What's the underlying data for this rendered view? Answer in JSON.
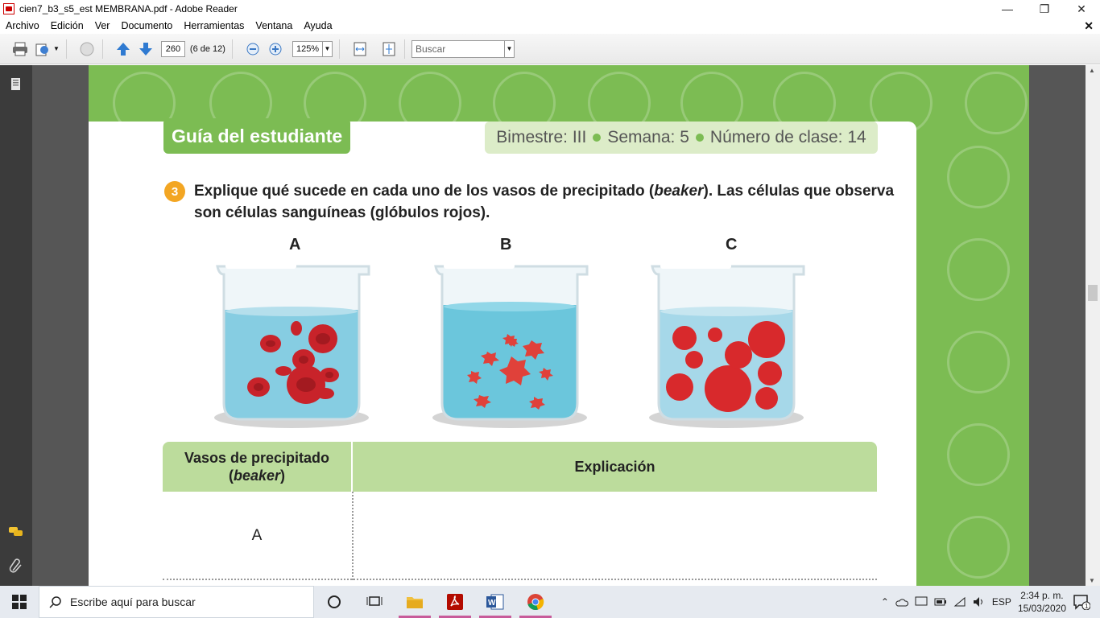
{
  "window": {
    "title": "cien7_b3_s5_est MEMBRANA.pdf - Adobe Reader"
  },
  "menu": [
    "Archivo",
    "Edición",
    "Ver",
    "Documento",
    "Herramientas",
    "Ventana",
    "Ayuda"
  ],
  "toolbar": {
    "page_number": "260",
    "page_count": "(6 de 12)",
    "zoom": "125%",
    "search_placeholder": "Buscar"
  },
  "document": {
    "header_title": "Guía del estudiante",
    "bimestre": "Bimestre: III",
    "semana": "Semana: 5",
    "clase": "Número de clase: 14",
    "question_number": "3",
    "question_part1": "Explique qué sucede en cada uno de los vasos de precipitado (",
    "question_italic": "beaker",
    "question_part2": "). Las células que observa son células sanguíneas (glóbulos rojos).",
    "beakers": [
      "A",
      "B",
      "C"
    ],
    "table_header_1_line1": "Vasos de precipitado",
    "table_header_1_open": "(",
    "table_header_1_italic": "beaker",
    "table_header_1_close": ")",
    "table_header_2": "Explicación",
    "row_label": "A"
  },
  "taskbar": {
    "search_text": "Escribe aquí para buscar",
    "language": "ESP",
    "time": "2:34 p. m.",
    "date": "15/03/2020",
    "notifications": "1"
  },
  "colors": {
    "green": "#7cbc53",
    "light_green": "#bcdc9c",
    "orange": "#f3a623",
    "water": "#5fc1dc",
    "cell_red": "#c8232a"
  }
}
